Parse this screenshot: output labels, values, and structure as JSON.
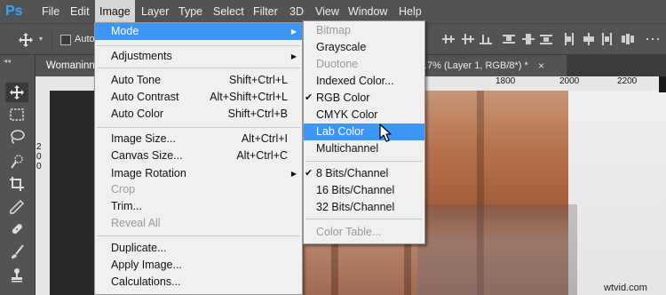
{
  "app": {
    "logo": "Ps"
  },
  "menubar": {
    "items": [
      {
        "label": "File"
      },
      {
        "label": "Edit"
      },
      {
        "label": "Image"
      },
      {
        "label": "Layer"
      },
      {
        "label": "Type"
      },
      {
        "label": "Select"
      },
      {
        "label": "Filter"
      },
      {
        "label": "3D"
      },
      {
        "label": "View"
      },
      {
        "label": "Window"
      },
      {
        "label": "Help"
      }
    ]
  },
  "options": {
    "auto_label": "Auto"
  },
  "document": {
    "tab_title": "Womaninn",
    "tab_title_right": ".7% (Layer 1, RGB/8*) *",
    "close_glyph": "×"
  },
  "rulers": {
    "top_ticks": [
      "1800",
      "2000",
      "2200"
    ],
    "left_ticks": "200"
  },
  "image_menu": {
    "items": [
      {
        "label": "Mode",
        "shortcut": "",
        "state": "highlight",
        "submenu": true
      },
      {
        "label": "Adjustments",
        "shortcut": "",
        "submenu": true
      },
      {
        "label": "Auto Tone",
        "shortcut": "Shift+Ctrl+L"
      },
      {
        "label": "Auto Contrast",
        "shortcut": "Alt+Shift+Ctrl+L"
      },
      {
        "label": "Auto Color",
        "shortcut": "Shift+Ctrl+B"
      },
      {
        "label": "Image Size...",
        "shortcut": "Alt+Ctrl+I"
      },
      {
        "label": "Canvas Size...",
        "shortcut": "Alt+Ctrl+C"
      },
      {
        "label": "Image Rotation",
        "shortcut": "",
        "submenu": true
      },
      {
        "label": "Crop",
        "shortcut": "",
        "state": "disabled"
      },
      {
        "label": "Trim...",
        "shortcut": ""
      },
      {
        "label": "Reveal All",
        "shortcut": "",
        "state": "disabled"
      },
      {
        "label": "Duplicate...",
        "shortcut": ""
      },
      {
        "label": "Apply Image...",
        "shortcut": ""
      },
      {
        "label": "Calculations...",
        "shortcut": ""
      }
    ]
  },
  "mode_submenu": {
    "items": [
      {
        "label": "Bitmap",
        "state": "disabled"
      },
      {
        "label": "Grayscale"
      },
      {
        "label": "Duotone",
        "state": "disabled"
      },
      {
        "label": "Indexed Color..."
      },
      {
        "label": "RGB Color",
        "checked": true
      },
      {
        "label": "CMYK Color"
      },
      {
        "label": "Lab Color",
        "state": "highlight"
      },
      {
        "label": "Multichannel"
      },
      {
        "label": "8 Bits/Channel",
        "checked": true
      },
      {
        "label": "16 Bits/Channel"
      },
      {
        "label": "32 Bits/Channel"
      },
      {
        "label": "Color Table...",
        "state": "disabled"
      }
    ]
  },
  "glyphs": {
    "check": "✔",
    "submenu_arrow": "▶",
    "collapse": "◂◂"
  },
  "watermark": "wtvid.com",
  "colors": {
    "highlight": "#3d95f5",
    "menubar": "#535353",
    "ps_blue": "#31a8ff"
  }
}
